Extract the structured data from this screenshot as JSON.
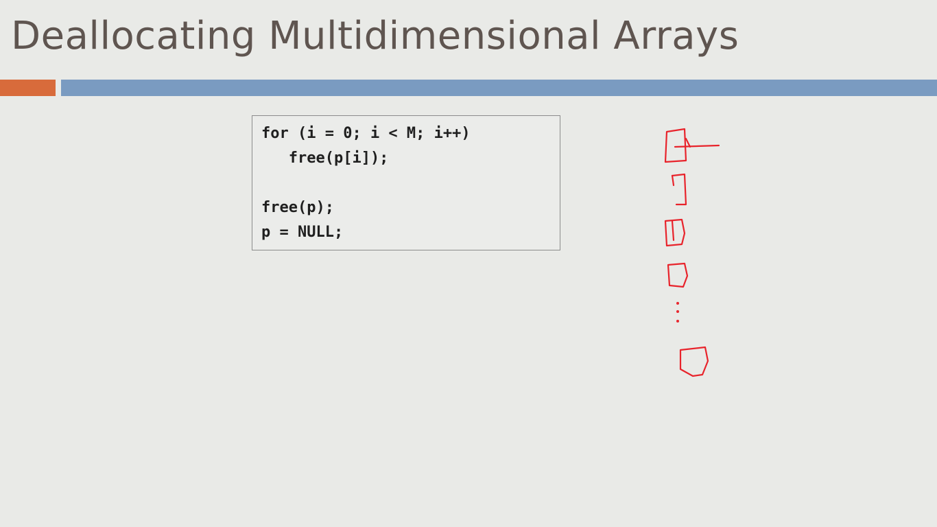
{
  "slide": {
    "title": "Deallocating Multidimensional Arrays"
  },
  "code": {
    "lines": [
      "for (i = 0; i < M; i++)",
      "   free(p[i]);",
      "",
      "free(p);",
      "p = NULL;"
    ]
  },
  "colors": {
    "accent_orange": "#d86b3b",
    "accent_blue": "#7a9bc1",
    "annotation_ink": "#e8232b"
  },
  "annotation": {
    "description_icon": "handwritten-array-of-boxes-icon"
  }
}
